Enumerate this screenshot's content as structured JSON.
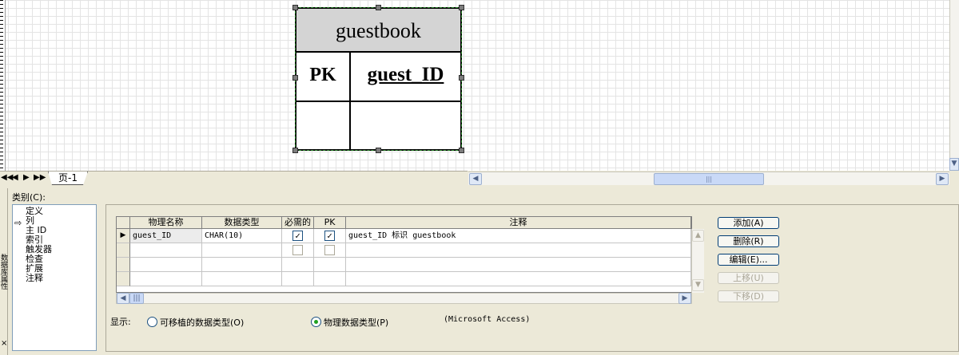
{
  "canvas": {
    "entity": {
      "title": "guestbook",
      "pk_label": "PK",
      "key_field": "guest_ID"
    }
  },
  "tabs": {
    "nav": [
      "◀◀",
      "◀",
      "▶",
      "▶▶"
    ],
    "page_tab": "页-1"
  },
  "properties": {
    "category_label": "类别(C):",
    "categories": [
      "定义",
      "列",
      "主 ID",
      "索引",
      "触发器",
      "检查",
      "扩展",
      "注释"
    ],
    "selected_category": "列",
    "columns_grid": {
      "headers": [
        "物理名称",
        "数据类型",
        "必需的",
        "PK",
        "注释"
      ],
      "rows": [
        {
          "name": "guest_ID",
          "type": "CHAR(10)",
          "required": true,
          "pk": true,
          "comment": "guest_ID 标识 guestbook"
        }
      ]
    },
    "buttons": {
      "add": "添加(A)",
      "delete": "删除(R)",
      "edit": "编辑(E)...",
      "move_up": "上移(U)",
      "move_down": "下移(D)"
    },
    "display": {
      "label": "显示:",
      "portable_types": "可移植的数据类型(O)",
      "physical_types": "物理数据类型(P)",
      "selected": "physical",
      "database": "(Microsoft Access)"
    }
  },
  "colors": {
    "selection_dash": "#2b8a2b",
    "entity_header": "#d4d4d4",
    "panel_bg": "#ece9d8"
  }
}
